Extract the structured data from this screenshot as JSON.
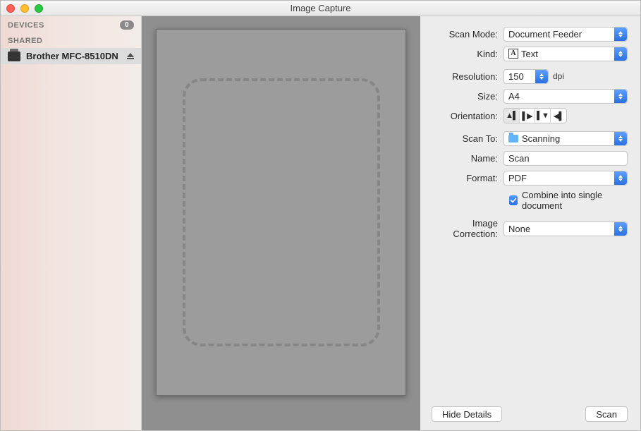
{
  "window": {
    "title": "Image Capture"
  },
  "sidebar": {
    "sections": {
      "devices": {
        "label": "DEVICES",
        "count": "0"
      },
      "shared": {
        "label": "SHARED"
      }
    },
    "items": [
      {
        "label": "Brother MFC-8510DN"
      }
    ]
  },
  "panel": {
    "scan_mode": {
      "label": "Scan Mode:",
      "value": "Document Feeder"
    },
    "kind": {
      "label": "Kind:",
      "value": "Text",
      "icon_letter": "A"
    },
    "resolution": {
      "label": "Resolution:",
      "value": "150",
      "unit": "dpi"
    },
    "size": {
      "label": "Size:",
      "value": "A4"
    },
    "orientation": {
      "label": "Orientation:"
    },
    "scan_to": {
      "label": "Scan To:",
      "value": "Scanning"
    },
    "name": {
      "label": "Name:",
      "value": "Scan"
    },
    "format": {
      "label": "Format:",
      "value": "PDF"
    },
    "combine": {
      "label": "Combine into single document"
    },
    "image_correction": {
      "label": "Image Correction:",
      "value": "None"
    }
  },
  "footer": {
    "hide_details": "Hide Details",
    "scan": "Scan"
  }
}
